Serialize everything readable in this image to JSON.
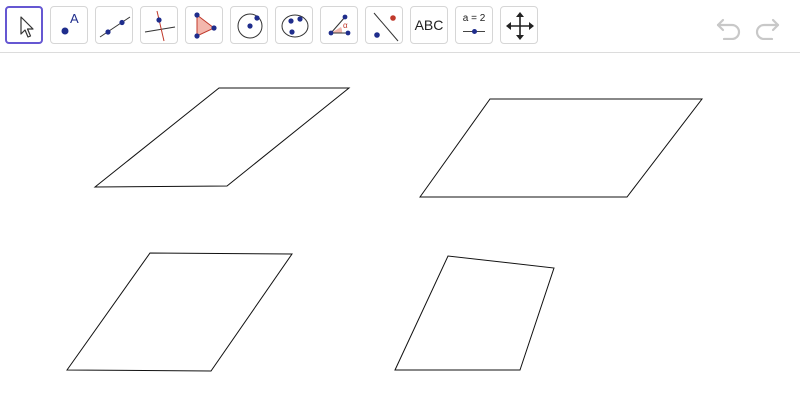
{
  "toolbar": {
    "tools": [
      {
        "name": "move-tool",
        "icon": "arrow-cursor-icon",
        "selected": true
      },
      {
        "name": "point-tool",
        "icon": "point-icon",
        "label": "A"
      },
      {
        "name": "line-tool",
        "icon": "line-icon"
      },
      {
        "name": "perpendicular-line-tool",
        "icon": "perpendicular-line-icon"
      },
      {
        "name": "polygon-tool",
        "icon": "polygon-icon"
      },
      {
        "name": "circle-tool",
        "icon": "circle-center-point-icon"
      },
      {
        "name": "conic-tool",
        "icon": "ellipse-icon"
      },
      {
        "name": "angle-tool",
        "icon": "angle-icon",
        "label": "α"
      },
      {
        "name": "reflect-tool",
        "icon": "reflect-about-line-icon"
      },
      {
        "name": "text-tool",
        "icon": "text-icon",
        "label": "ABC"
      },
      {
        "name": "slider-tool",
        "icon": "slider-icon",
        "label": "a = 2"
      },
      {
        "name": "move-graphics-tool",
        "icon": "move-graphics-view-icon"
      }
    ],
    "undo_icon": "undo-icon",
    "redo_icon": "redo-icon"
  },
  "colors": {
    "selected_border": "#6557d2",
    "point_blue": "#1f2d8c",
    "accent_red": "#c0392b",
    "polygon_fill": "#f3b7ad",
    "history_gray": "#c8c8c8"
  }
}
